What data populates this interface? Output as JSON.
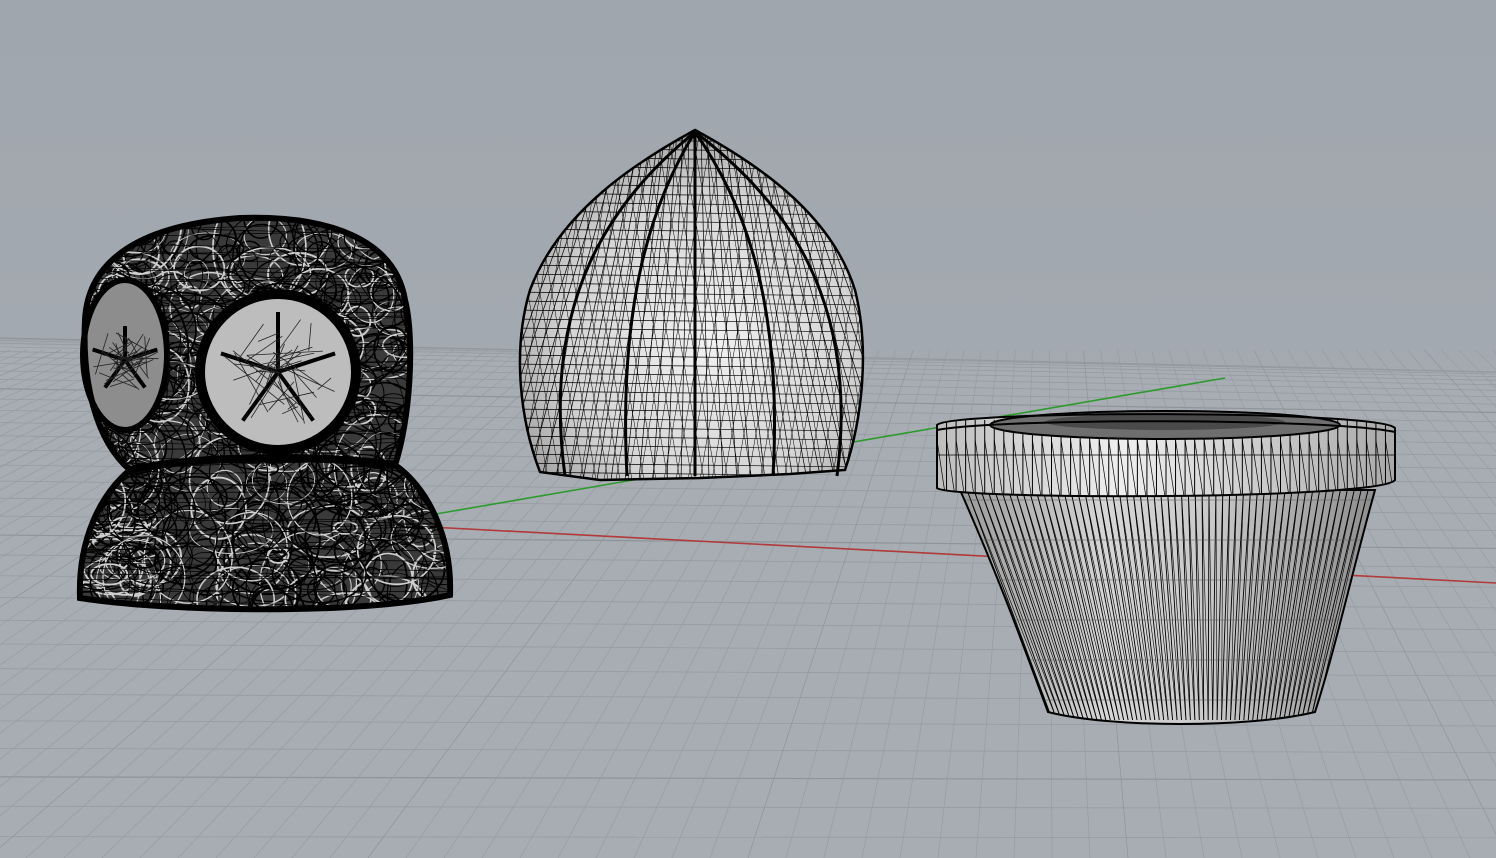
{
  "viewport": {
    "background": "#9ea4ab",
    "grid_color": "#8a9097",
    "grid_major_color": "#7b8188",
    "x_axis_color": "#b23a3a",
    "y_axis_color": "#2d9a2d",
    "mesh_fill": "#d9d9d9",
    "mesh_line": "#000000"
  },
  "objects": [
    {
      "name": "skull-mesh",
      "shading": "wireframe-dense"
    },
    {
      "name": "onion-dome-mesh",
      "shading": "shaded-triangulated"
    },
    {
      "name": "flower-pot-mesh",
      "shading": "shaded-triangulated"
    }
  ]
}
